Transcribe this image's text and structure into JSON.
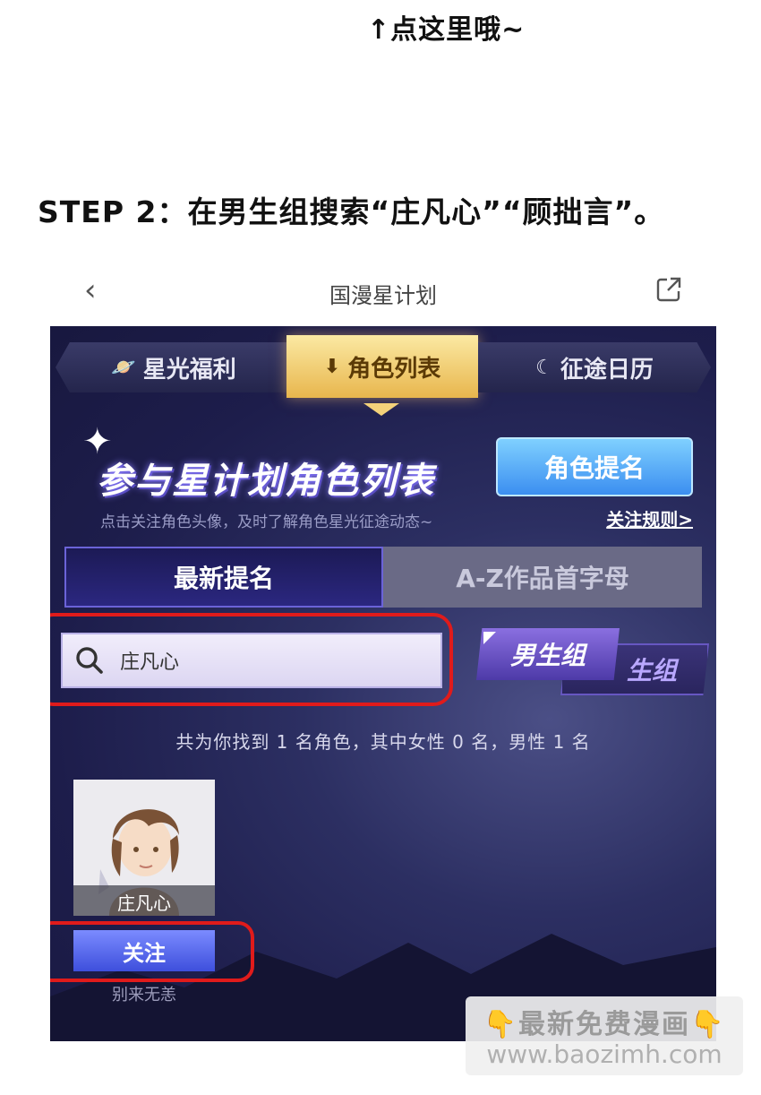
{
  "hint_text": "↑点这里哦~",
  "step_text": "STEP 2：在男生组搜索“庄凡心”“顾拙言”。",
  "topbar": {
    "title": "国漫星计划"
  },
  "nav_tabs": [
    "星光福利",
    "角色列表",
    "征途日历"
  ],
  "banner": {
    "title": "参与星计划角色列表",
    "nominate_button": "角色提名",
    "description": "点击关注角色头像，及时了解角色星光征途动态~",
    "rules_link": "关注规则>"
  },
  "sub_tabs": [
    "最新提名",
    "A-Z作品首字母"
  ],
  "search": {
    "value": "庄凡心"
  },
  "groups": {
    "male": "男生组",
    "female_partial": "生组"
  },
  "result_summary": "共为你找到 1 名角色，其中女性 0 名，男性 1 名",
  "character": {
    "name": "庄凡心",
    "follow_label": "关注",
    "tagline": "别来无恙"
  },
  "watermark": {
    "line1": "最新免费漫画",
    "line2": "www.baozimh.com"
  },
  "colors": {
    "highlight_red": "#e01b1b",
    "active_tab_gold": "#e8b64d",
    "follow_blue": "#3e4fdc"
  }
}
